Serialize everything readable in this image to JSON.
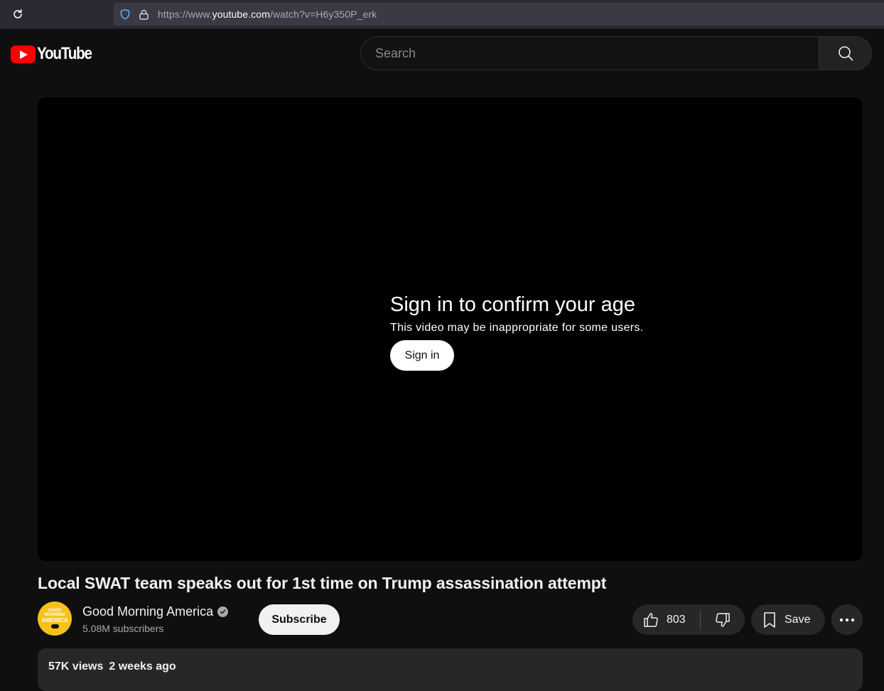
{
  "browser": {
    "url_prefix": "https://www.",
    "url_host": "youtube.com",
    "url_path": "/watch?v=H6y350P_erk"
  },
  "masthead": {
    "logo_text": "YouTube",
    "search_placeholder": "Search"
  },
  "player": {
    "age_title": "Sign in to confirm your age",
    "age_subtitle": "This video may be inappropriate for some users.",
    "signin_label": "Sign in"
  },
  "video": {
    "title": "Local SWAT team speaks out for 1st time on Trump assassination attempt"
  },
  "owner": {
    "channel_name": "Good Morning America",
    "subscribers": "5.08M subscribers",
    "subscribe_label": "Subscribe",
    "avatar_line1": "GOOD",
    "avatar_line2": "MORNING",
    "avatar_line3": "AMERICA"
  },
  "actions": {
    "like_count": "803",
    "save_label": "Save"
  },
  "description": {
    "views": "57K views",
    "date": "2 weeks ago"
  },
  "colors": {
    "background": "#0f0f0f",
    "brand_red": "#ff0000",
    "button_bg": "#272727"
  }
}
